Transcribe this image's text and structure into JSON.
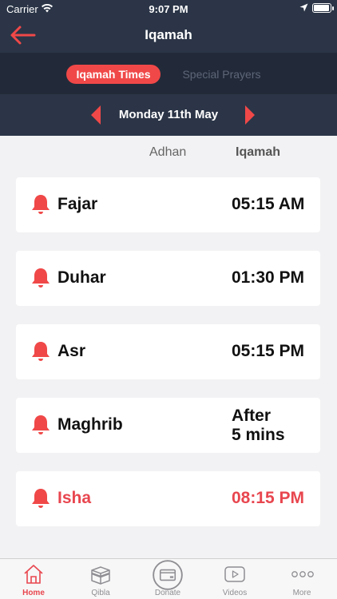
{
  "status_bar": {
    "carrier": "Carrier",
    "time": "9:07 PM"
  },
  "nav": {
    "title": "Iqamah",
    "back_icon": "arrow-left-icon"
  },
  "segments": {
    "active": "Iqamah Times",
    "inactive": "Special Prayers"
  },
  "date": {
    "label": "Monday 11th May"
  },
  "columns": {
    "adhan": "Adhan",
    "iqamah": "Iqamah"
  },
  "prayers": [
    {
      "name": "Fajar",
      "time": "05:15 AM",
      "time_line2": ""
    },
    {
      "name": "Duhar",
      "time": "01:30 PM",
      "time_line2": ""
    },
    {
      "name": "Asr",
      "time": "05:15 PM",
      "time_line2": ""
    },
    {
      "name": "Maghrib",
      "time": "After",
      "time_line2": "5 mins"
    },
    {
      "name": "Isha",
      "time": "08:15 PM",
      "time_line2": ""
    }
  ],
  "tabs": [
    {
      "label": "Home",
      "icon": "home-icon"
    },
    {
      "label": "Qibla",
      "icon": "kaaba-icon"
    },
    {
      "label": "Donate",
      "icon": "card-icon"
    },
    {
      "label": "Videos",
      "icon": "play-icon"
    },
    {
      "label": "More",
      "icon": "more-icon"
    }
  ],
  "colors": {
    "accent": "#e8464f",
    "header": "#2b3547",
    "segment_bg": "#222a39"
  }
}
